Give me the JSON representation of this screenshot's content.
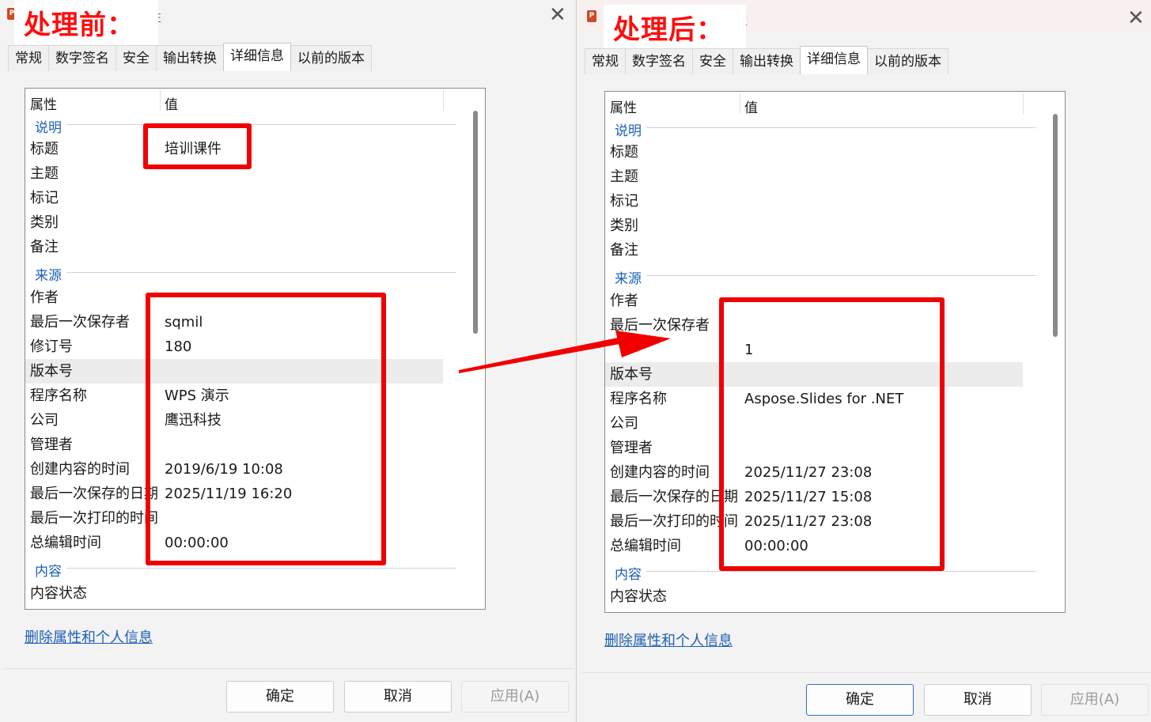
{
  "left": {
    "window_title": "性",
    "overlay_label": "处理前：",
    "tabs": [
      "常规",
      "数字签名",
      "安全",
      "输出转换",
      "详细信息",
      "以前的版本"
    ],
    "active_tab": "详细信息",
    "col_property": "属性",
    "col_value": "值",
    "groups": {
      "desc": "说明",
      "origin": "来源",
      "content": "内容"
    },
    "rows": {
      "title": {
        "name": "标题",
        "value": "培训课件"
      },
      "subject": {
        "name": "主题",
        "value": ""
      },
      "tags": {
        "name": "标记",
        "value": ""
      },
      "category": {
        "name": "类别",
        "value": ""
      },
      "comments": {
        "name": "备注",
        "value": ""
      },
      "author": {
        "name": "作者",
        "value": ""
      },
      "last_saved_by": {
        "name": "最后一次保存者",
        "value": "sqmil"
      },
      "revision": {
        "name": "修订号",
        "value": "180"
      },
      "version": {
        "name": "版本号",
        "value": ""
      },
      "program": {
        "name": "程序名称",
        "value": "WPS 演示"
      },
      "company": {
        "name": "公司",
        "value": "鹰迅科技"
      },
      "manager": {
        "name": "管理者",
        "value": ""
      },
      "created": {
        "name": "创建内容的时间",
        "value": "2019/6/19 10:08"
      },
      "last_saved": {
        "name": "最后一次保存的日期",
        "value": "2025/11/19 16:20"
      },
      "last_printed": {
        "name": "最后一次打印的时间",
        "value": ""
      },
      "total_edit": {
        "name": "总编辑时间",
        "value": "00:00:00"
      },
      "content_status": {
        "name": "内容状态",
        "value": ""
      }
    },
    "remove_link": "删除属性和个人信息",
    "buttons": {
      "ok": "确定",
      "cancel": "取消",
      "apply": "应用(A)"
    }
  },
  "right": {
    "window_title": "生",
    "overlay_label": "处理后：",
    "tabs": [
      "常规",
      "数字签名",
      "安全",
      "输出转换",
      "详细信息",
      "以前的版本"
    ],
    "active_tab": "详细信息",
    "col_property": "属性",
    "col_value": "值",
    "groups": {
      "desc": "说明",
      "origin": "来源",
      "content": "内容"
    },
    "rows": {
      "title": {
        "name": "标题",
        "value": ""
      },
      "subject": {
        "name": "主题",
        "value": ""
      },
      "tags": {
        "name": "标记",
        "value": ""
      },
      "category": {
        "name": "类别",
        "value": ""
      },
      "comments": {
        "name": "备注",
        "value": ""
      },
      "author": {
        "name": "作者",
        "value": ""
      },
      "last_saved_by": {
        "name": "最后一次保存者",
        "value": ""
      },
      "revision": {
        "name": "",
        "value": "1"
      },
      "version": {
        "name": "版本号",
        "value": ""
      },
      "program": {
        "name": "程序名称",
        "value": "Aspose.Slides for .NET"
      },
      "company": {
        "name": "公司",
        "value": ""
      },
      "manager": {
        "name": "管理者",
        "value": ""
      },
      "created": {
        "name": "创建内容的时间",
        "value": "2025/11/27 23:08"
      },
      "last_saved": {
        "name": "最后一次保存的日期",
        "value": "2025/11/27 15:08"
      },
      "last_printed": {
        "name": "最后一次打印的时间",
        "value": "2025/11/27 23:08"
      },
      "total_edit": {
        "name": "总编辑时间",
        "value": "00:00:00"
      },
      "content_status": {
        "name": "内容状态",
        "value": ""
      }
    },
    "remove_link": "删除属性和个人信息",
    "buttons": {
      "ok": "确定",
      "cancel": "取消",
      "apply": "应用(A)"
    }
  },
  "annotation_color": "#f00000"
}
